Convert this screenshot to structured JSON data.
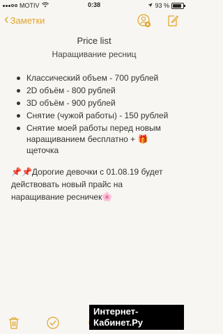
{
  "status_bar": {
    "carrier": "MOTIV",
    "time": "0:38",
    "battery_percent_text": "93 %",
    "battery_level": 0.93
  },
  "nav": {
    "back_label": "Заметки"
  },
  "note": {
    "title": "Price list",
    "subtitle": "Наращивание ресниц",
    "items": [
      "Классический объем - 700 рублей",
      "2D объём - 800 рублей",
      "3D объём - 900 рублей",
      "Снятие (чужой работы) - 150 рублей",
      "Снятие моей работы перед новым наращиванием бесплатно + 🎁 щеточка"
    ],
    "announcement": "📌📌Дорогие девочки с 01.08.19 будет действовать новый прайс на наращивание ресничек🌸"
  },
  "watermark": "Интернет-Кабинет.Ру",
  "icons": {
    "accent": "#e2a329"
  }
}
